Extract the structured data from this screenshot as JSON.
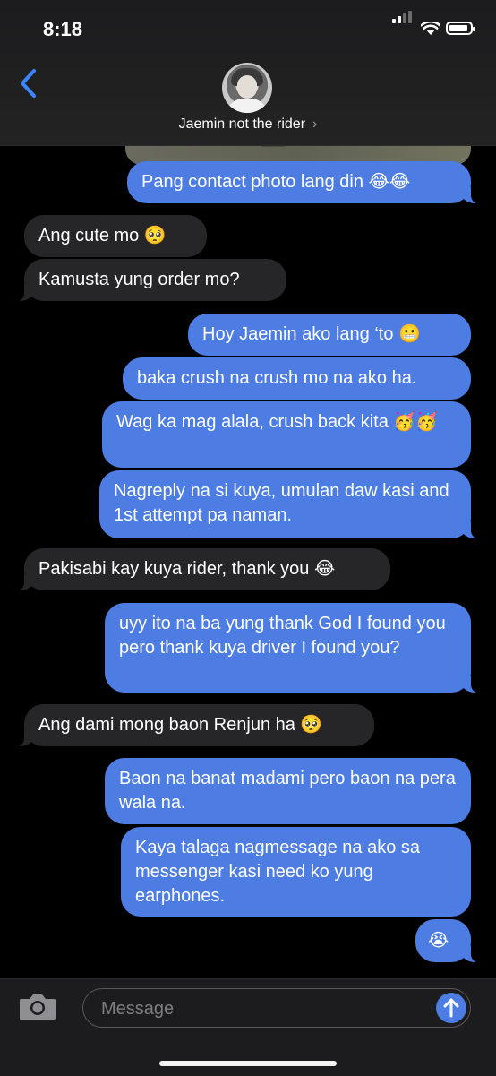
{
  "status_bar": {
    "time": "8:18"
  },
  "header": {
    "contact_name": "Jaemin not the rider",
    "chevron": "›"
  },
  "messages": [
    {
      "from": "me",
      "text": "Pang contact photo lang din 😂😂"
    },
    {
      "from": "them",
      "text": "Ang cute mo 🥺"
    },
    {
      "from": "them",
      "text": "Kamusta yung order mo?"
    },
    {
      "from": "me",
      "text": "Hoy Jaemin ako lang ‘to 😬"
    },
    {
      "from": "me",
      "text": "baka crush na crush mo na ako ha."
    },
    {
      "from": "me",
      "text": "Wag ka mag alala, crush back kita 🥳🥳"
    },
    {
      "from": "me",
      "text": "Nagreply na si kuya, umulan daw kasi and 1st attempt pa naman."
    },
    {
      "from": "them",
      "text": "Pakisabi kay kuya rider, thank you 😂"
    },
    {
      "from": "me",
      "text": "uyy ito na ba yung thank God I found you pero thank kuya driver I found you?"
    },
    {
      "from": "them",
      "text": "Ang dami mong baon Renjun ha 🥺"
    },
    {
      "from": "me",
      "text": "Baon na banat madami pero baon na pera wala na."
    },
    {
      "from": "me",
      "text": "Kaya talaga nagmessage na ako sa messenger kasi need ko yung earphones."
    },
    {
      "from": "me",
      "text": "😭"
    }
  ],
  "input": {
    "placeholder": "Message"
  },
  "colors": {
    "outgoing": "#4d7de3",
    "incoming": "#262628",
    "accent": "#3a86ff"
  }
}
